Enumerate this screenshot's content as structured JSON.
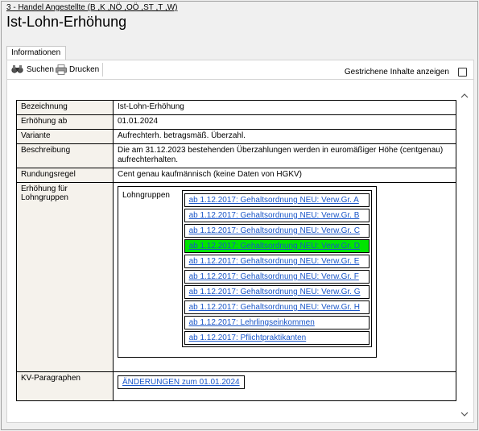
{
  "breadcrumb": "3 - Handel Angestellte (B ,K ,NÖ ,OÖ ,ST ,T ,W)",
  "page_title": "Ist-Lohn-Erhöhung",
  "tabs": [
    {
      "label": "Informationen",
      "active": true
    }
  ],
  "toolbar": {
    "search_label": "Suchen",
    "print_label": "Drucken",
    "show_struck_label": "Gestrichene Inhalte anzeigen",
    "show_struck_checked": false
  },
  "info": {
    "bezeichnung": {
      "label": "Bezeichnung",
      "value": "Ist-Lohn-Erhöhung"
    },
    "erhoehung_ab": {
      "label": "Erhöhung ab",
      "value": "01.01.2024"
    },
    "variante": {
      "label": "Variante",
      "value": "Aufrechterh. betragsmäß. Überzahl."
    },
    "beschreibung": {
      "label": "Beschreibung",
      "value": "Die am 31.12.2023 bestehenden Überzahlungen werden in euromäßiger Höhe (centgenau) aufrechterhalten."
    },
    "rundungsregel": {
      "label": "Rundungsregel",
      "value": "Cent genau kaufmännisch (keine Daten von HGKV)"
    },
    "lohngruppen": {
      "label": "Erhöhung für Lohngruppen",
      "inner_label": "Lohngruppen",
      "items": [
        {
          "text": "ab 1.12.2017: Gehaltsordnung NEU: Verw.Gr. A",
          "highlighted": false
        },
        {
          "text": "ab 1.12.2017: Gehaltsordnung NEU: Verw.Gr. B",
          "highlighted": false
        },
        {
          "text": "ab 1.12.2017: Gehaltsordnung NEU: Verw.Gr. C",
          "highlighted": false
        },
        {
          "text": "ab 1.12.2017: Gehaltsordnung NEU: Verw.Gr. D",
          "highlighted": true
        },
        {
          "text": "ab 1.12.2017: Gehaltsordnung NEU: Verw.Gr. E",
          "highlighted": false
        },
        {
          "text": "ab 1.12.2017: Gehaltsordnung NEU: Verw.Gr. F",
          "highlighted": false
        },
        {
          "text": "ab 1.12.2017: Gehaltsordnung NEU: Verw.Gr. G",
          "highlighted": false
        },
        {
          "text": "ab 1.12.2017: Gehaltsordnung NEU: Verw.Gr. H",
          "highlighted": false
        },
        {
          "text": "ab 1.12.2017: Lehrlingseinkommen",
          "highlighted": false
        },
        {
          "text": "ab 1.12.2017: Pflichtpraktikanten",
          "highlighted": false
        }
      ]
    },
    "kv_paragraphen": {
      "label": "KV-Paragraphen",
      "button_label": "ÄNDERUNGEN zum 01.01.2024"
    }
  },
  "colors": {
    "link": "#1a56c8",
    "highlight": "#00e400",
    "label_bg": "#f5f2ec"
  }
}
